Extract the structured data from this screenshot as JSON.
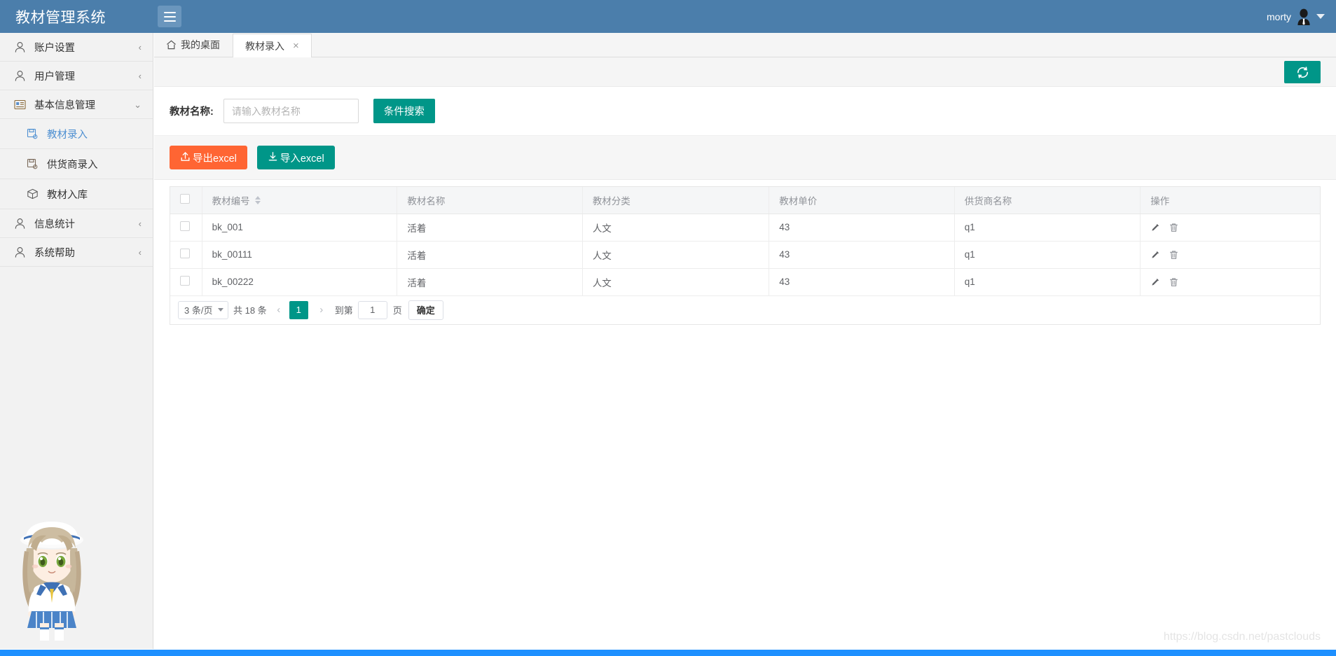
{
  "header": {
    "brand_title": "教材管理系统",
    "menu_toggle_icon": "hamburger-icon",
    "user_name": "morty",
    "avatar_icon": "user-avatar-icon",
    "caret_icon": "caret-down-icon"
  },
  "sidebar": {
    "items": [
      {
        "label": "账户设置",
        "icon": "user-icon",
        "arrow": "chevron-left",
        "level": 1,
        "active": false
      },
      {
        "label": "用户管理",
        "icon": "user-icon",
        "arrow": "chevron-left",
        "level": 1,
        "active": false
      },
      {
        "label": "基本信息管理",
        "icon": "id-card-icon",
        "arrow": "chevron-down",
        "level": 1,
        "active": false
      },
      {
        "label": "教材录入",
        "icon": "file-save-icon",
        "arrow": "",
        "level": 2,
        "active": true
      },
      {
        "label": "供货商录入",
        "icon": "file-save-icon",
        "arrow": "",
        "level": 2,
        "active": false
      },
      {
        "label": "教材入库",
        "icon": "box-icon",
        "arrow": "",
        "level": 2,
        "active": false
      },
      {
        "label": "信息统计",
        "icon": "user-icon",
        "arrow": "chevron-left",
        "level": 1,
        "active": false
      },
      {
        "label": "系统帮助",
        "icon": "user-icon",
        "arrow": "chevron-left",
        "level": 1,
        "active": false
      }
    ],
    "mascot_icon": "anime-mascot-illustration"
  },
  "tabs": [
    {
      "label": "我的桌面",
      "icon": "home-icon",
      "active": false,
      "closable": false
    },
    {
      "label": "教材录入",
      "icon": "",
      "active": true,
      "closable": true,
      "close_glyph": "×"
    }
  ],
  "toolbar": {
    "refresh_icon": "refresh-icon"
  },
  "search": {
    "label": "教材名称:",
    "placeholder": "请输入教材名称",
    "value": "",
    "button_label": "条件搜索"
  },
  "actions": {
    "export_label": "导出excel",
    "export_icon": "upload-icon",
    "export_color": "#ff6533",
    "import_label": "导入excel",
    "import_icon": "download-icon",
    "import_color": "#009688"
  },
  "table": {
    "columns": [
      {
        "key": "check",
        "label": "",
        "sortable": false
      },
      {
        "key": "code",
        "label": "教材编号",
        "sortable": true
      },
      {
        "key": "name",
        "label": "教材名称",
        "sortable": false
      },
      {
        "key": "category",
        "label": "教材分类",
        "sortable": false
      },
      {
        "key": "price",
        "label": "教材单价",
        "sortable": false
      },
      {
        "key": "supplier",
        "label": "供货商名称",
        "sortable": false
      },
      {
        "key": "ops",
        "label": "操作",
        "sortable": false
      }
    ],
    "rows": [
      {
        "code": "bk_001",
        "name": "活着",
        "category": "人文",
        "price": "43",
        "supplier": "q1",
        "checked": false
      },
      {
        "code": "bk_00111",
        "name": "活着",
        "category": "人文",
        "price": "43",
        "supplier": "q1",
        "checked": false
      },
      {
        "code": "bk_00222",
        "name": "活着",
        "category": "人文",
        "price": "43",
        "supplier": "q1",
        "checked": false
      }
    ],
    "row_ops": {
      "edit_icon": "pencil-icon",
      "delete_icon": "trash-icon"
    }
  },
  "pagination": {
    "page_size_label": "3 条/页",
    "total_label": "共 18 条",
    "prev_glyph": "‹",
    "next_glyph": "›",
    "current_page": "1",
    "jump_prefix": "到第",
    "jump_value": "1",
    "jump_unit": "页",
    "confirm_label": "确定",
    "accent_color": "#009688"
  },
  "watermark": {
    "text": "https://blog.csdn.net/pastclouds"
  }
}
